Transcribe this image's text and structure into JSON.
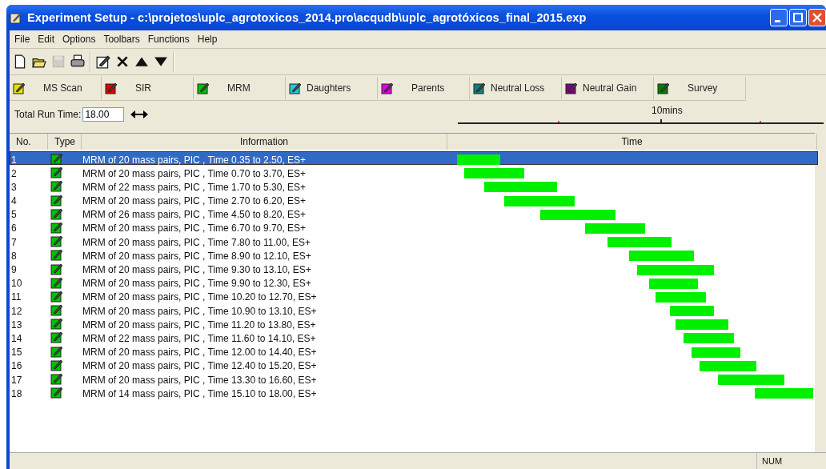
{
  "window": {
    "title": "Experiment Setup - c:\\projetos\\uplc_agrotoxicos_2014.pro\\acqudb\\uplc_agrotóxicos_final_2015.exp"
  },
  "menu": [
    "File",
    "Edit",
    "Options",
    "Toolbars",
    "Functions",
    "Help"
  ],
  "toolbar": [
    {
      "kind": "new",
      "disabled": false
    },
    {
      "kind": "open",
      "disabled": false
    },
    {
      "kind": "save",
      "disabled": true
    },
    {
      "kind": "print",
      "disabled": false
    },
    {
      "kind": "edit",
      "disabled": false
    },
    {
      "kind": "delete",
      "disabled": false
    },
    {
      "kind": "up",
      "disabled": false
    },
    {
      "kind": "down",
      "disabled": false
    }
  ],
  "mode_buttons": [
    {
      "label": "MS Scan",
      "color": "#e8e000"
    },
    {
      "label": "SIR",
      "color": "#e00000"
    },
    {
      "label": "MRM",
      "color": "#00c000"
    },
    {
      "label": "Daughters",
      "color": "#20c8d8"
    },
    {
      "label": "Parents",
      "color": "#e000e0"
    },
    {
      "label": "Neutral Loss",
      "color": "#108080"
    },
    {
      "label": "Neutral Gain",
      "color": "#800080"
    },
    {
      "label": "Survey",
      "color": "#008000"
    }
  ],
  "run_time": {
    "label": "Total Run Time:",
    "value": "18.00"
  },
  "timeline": {
    "label": "10mins"
  },
  "table": {
    "columns": [
      "No.",
      "Type",
      "Information",
      "Time"
    ],
    "rows": [
      {
        "no": "1",
        "kind": "mrm",
        "info": "MRM of 20 mass pairs, PIC , Time 0.35 to 2.50, ES+",
        "selected": true
      },
      {
        "no": "2",
        "kind": "mrm",
        "info": "MRM of 20 mass pairs, PIC , Time 0.70 to 3.70, ES+",
        "selected": false
      },
      {
        "no": "3",
        "kind": "mrm",
        "info": "MRM of 22 mass pairs, PIC , Time 1.70 to 5.30, ES+",
        "selected": false
      },
      {
        "no": "4",
        "kind": "mrm",
        "info": "MRM of 20 mass pairs, PIC , Time 2.70 to 6.20, ES+",
        "selected": false
      },
      {
        "no": "5",
        "kind": "mrm",
        "info": "MRM of 26 mass pairs, PIC , Time 4.50 to 8.20, ES+",
        "selected": false
      },
      {
        "no": "6",
        "kind": "mrm",
        "info": "MRM of 20 mass pairs, PIC , Time 6.70 to 9.70, ES+",
        "selected": false
      },
      {
        "no": "7",
        "kind": "mrm",
        "info": "MRM of 20 mass pairs, PIC , Time 7.80 to 11.00, ES+",
        "selected": false
      },
      {
        "no": "8",
        "kind": "mrm",
        "info": "MRM of 20 mass pairs, PIC , Time 8.90 to 12.10, ES+",
        "selected": false
      },
      {
        "no": "9",
        "kind": "mrm",
        "info": "MRM of 20 mass pairs, PIC , Time 9.30 to 13.10, ES+",
        "selected": false
      },
      {
        "no": "10",
        "kind": "mrm",
        "info": "MRM of 20 mass pairs, PIC , Time 9.90 to 12.30, ES+",
        "selected": false
      },
      {
        "no": "11",
        "kind": "mrm",
        "info": "MRM of 20 mass pairs, PIC , Time 10.20 to 12.70, ES+",
        "selected": false
      },
      {
        "no": "12",
        "kind": "mrm",
        "info": "MRM of 20 mass pairs, PIC , Time 10.90 to 13.10, ES+",
        "selected": false
      },
      {
        "no": "13",
        "kind": "mrm",
        "info": "MRM of 20 mass pairs, PIC , Time 11.20 to 13.80, ES+",
        "selected": false
      },
      {
        "no": "14",
        "kind": "mrm",
        "info": "MRM of 22 mass pairs, PIC , Time 11.60 to 14.10, ES+",
        "selected": false
      },
      {
        "no": "15",
        "kind": "mrm",
        "info": "MRM of 20 mass pairs, PIC , Time 12.00 to 14.40, ES+",
        "selected": false
      },
      {
        "no": "16",
        "kind": "mrm",
        "info": "MRM of 20 mass pairs, PIC , Time 12.40 to 15.20, ES+",
        "selected": false
      },
      {
        "no": "17",
        "kind": "mrm",
        "info": "MRM of 20 mass pairs, PIC , Time 13.30 to 16.60, ES+",
        "selected": false
      },
      {
        "no": "18",
        "kind": "mrm",
        "info": "MRM of 14 mass pairs, PIC , Time 15.10 to 18.00, ES+",
        "selected": false
      }
    ]
  },
  "status_bar": {
    "indicator": "NUM"
  }
}
